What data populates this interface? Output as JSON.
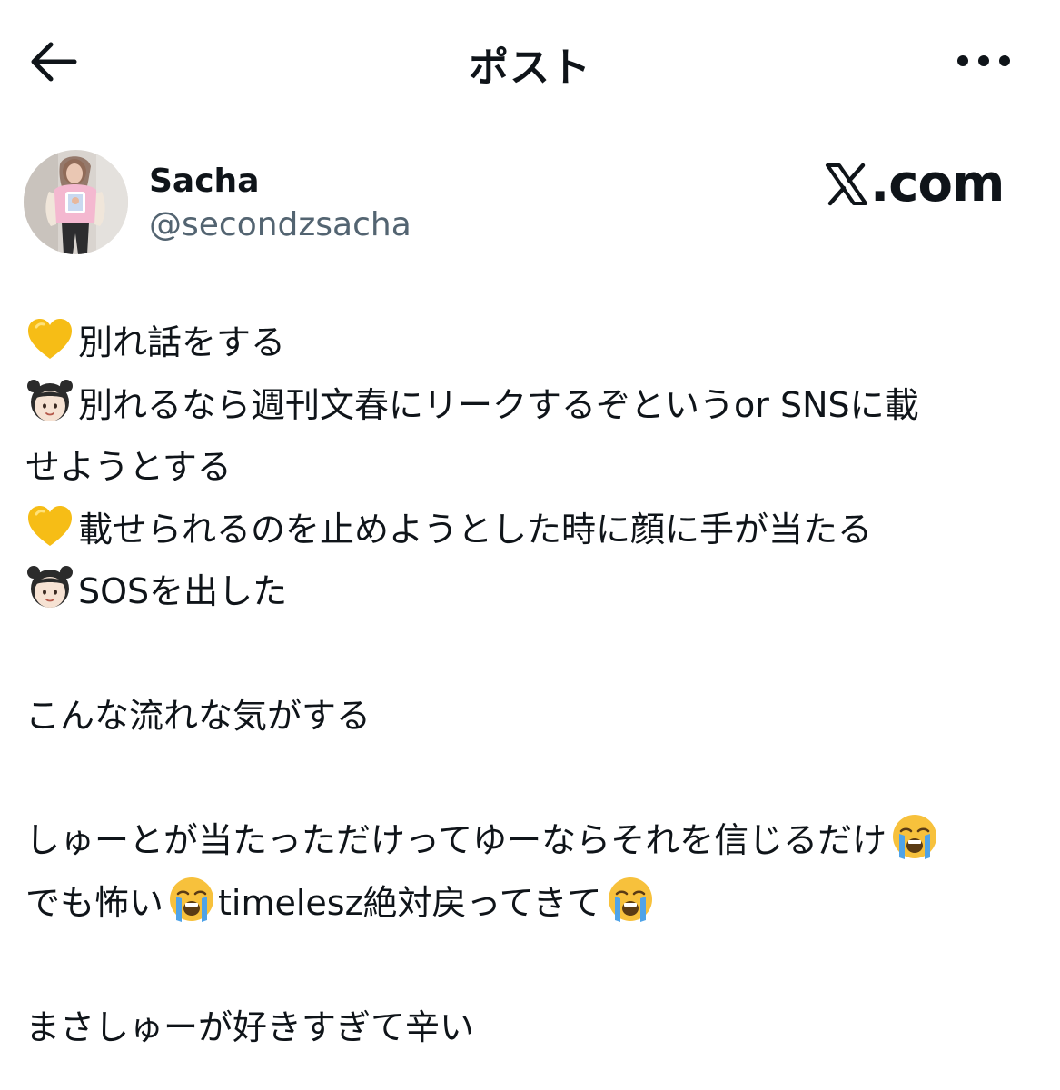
{
  "header": {
    "title": "ポスト"
  },
  "author": {
    "display_name": "Sacha",
    "handle": "@secondzsacha"
  },
  "watermark": {
    "text": ".com"
  },
  "tweet": {
    "line1": "別れ話をする",
    "line2": "別れるなら週刊文春にリークするぞというor SNSに載",
    "line3": "せようとする",
    "line4": "載せられるのを止めようとした時に顔に手が当たる",
    "line5": "SOSを出した",
    "line6": "こんな流れな気がする",
    "line7": "しゅーとが当たっただけってゆーならそれを信じるだけ",
    "line8a": "でも怖い",
    "line8b": "timelesz絶対戻ってきて",
    "line9": "まさしゅーが好きすぎて辛い"
  },
  "icons": {
    "back": "arrow-left-icon",
    "more": "more-horizontal-icon",
    "heart": "yellow-heart-emoji",
    "girl": "girl-emoji",
    "crying": "loudly-crying-face-emoji"
  },
  "colors": {
    "text": "#0f1419",
    "secondary": "#536471",
    "heart": "#f8c21a",
    "crying": "#f7c13c",
    "tears": "#4fa3e8"
  }
}
